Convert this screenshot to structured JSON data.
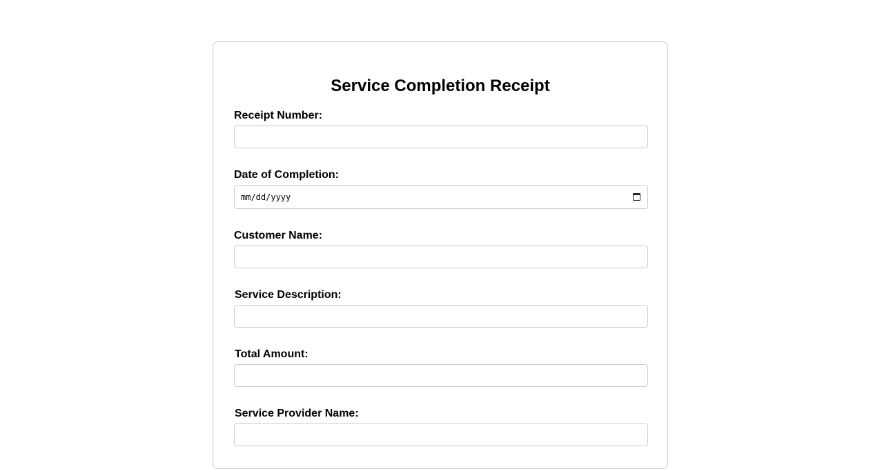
{
  "form": {
    "title": "Service Completion Receipt",
    "fields": [
      {
        "label": "Receipt Number:",
        "value": "",
        "type": "text"
      },
      {
        "label": "Date of Completion:",
        "value": "",
        "type": "date",
        "placeholder": "mm/dd/yyyy"
      },
      {
        "label": "Customer Name:",
        "value": "",
        "type": "text"
      },
      {
        "label": "Service Description:",
        "value": "",
        "type": "text"
      },
      {
        "label": "Total Amount:",
        "value": "",
        "type": "text"
      },
      {
        "label": "Service Provider Name:",
        "value": "",
        "type": "text"
      }
    ]
  },
  "icons": {
    "date_picker": "calendar-icon"
  },
  "colors": {
    "border": "#cccccc",
    "text": "#000000",
    "background": "#ffffff"
  }
}
